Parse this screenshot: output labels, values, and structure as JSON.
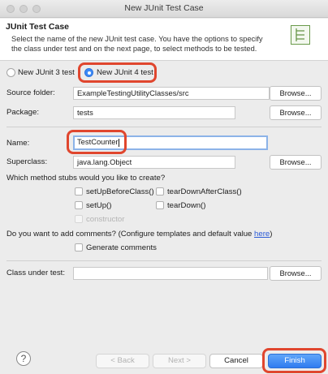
{
  "window": {
    "title": "New JUnit Test Case"
  },
  "header": {
    "title": "JUnit Test Case",
    "description": "Select the name of the new JUnit test case. You have the options to specify the class under test and on the next page, to select methods to be tested.",
    "icon": "junit-wizard-icon"
  },
  "version": {
    "junit3_label": "New JUnit 3 test",
    "junit4_label": "New JUnit 4 test",
    "selected": "junit4"
  },
  "source_folder": {
    "label": "Source folder:",
    "value": "ExampleTestingUtilityClasses/src",
    "browse": "Browse..."
  },
  "package": {
    "label": "Package:",
    "value": "tests",
    "browse": "Browse..."
  },
  "name": {
    "label": "Name:",
    "value": "TestCounter"
  },
  "superclass": {
    "label": "Superclass:",
    "value": "java.lang.Object",
    "browse": "Browse..."
  },
  "stubs": {
    "question": "Which method stubs would you like to create?",
    "setUpBeforeClass": "setUpBeforeClass()",
    "tearDownAfterClass": "tearDownAfterClass()",
    "setUp": "setUp()",
    "tearDown": "tearDown()",
    "constructor": "constructor"
  },
  "comments": {
    "question_prefix": "Do you want to add comments? (Configure templates and default value ",
    "link": "here",
    "question_suffix": ")",
    "generate": "Generate comments"
  },
  "class_under_test": {
    "label": "Class under test:",
    "value": "",
    "browse": "Browse..."
  },
  "footer": {
    "help": "?",
    "back": "< Back",
    "next": "Next >",
    "cancel": "Cancel",
    "finish": "Finish"
  },
  "colors": {
    "highlight": "#e0462e",
    "accent": "#3d8af7"
  }
}
